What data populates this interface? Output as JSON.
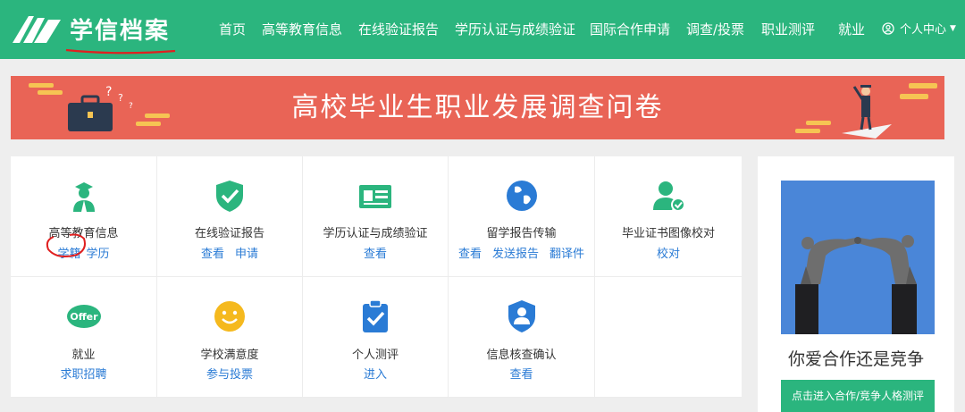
{
  "header": {
    "logo_text": "学信档案",
    "nav": [
      "首页",
      "高等教育信息",
      "在线验证报告",
      "学历认证与成绩验证",
      "国际合作申请",
      "调查/投票",
      "职业测评",
      "就业"
    ],
    "user_center": "个人中心",
    "brand_color": "#2bb57e"
  },
  "banner": {
    "title": "高校毕业生职业发展调查问卷",
    "color": "#e96456"
  },
  "services": [
    {
      "title": "高等教育信息",
      "links": [
        "学籍",
        "学历"
      ],
      "icon": "graduate-icon"
    },
    {
      "title": "在线验证报告",
      "links": [
        "查看",
        "申请"
      ],
      "icon": "shield-check-icon"
    },
    {
      "title": "学历认证与成绩验证",
      "links": [
        "查看"
      ],
      "icon": "id-card-icon"
    },
    {
      "title": "留学报告传输",
      "links": [
        "查看",
        "发送报告",
        "翻译件"
      ],
      "icon": "globe-icon"
    },
    {
      "title": "毕业证书图像校对",
      "links": [
        "校对"
      ],
      "icon": "user-check-icon"
    },
    {
      "title": "就业",
      "links": [
        "求职招聘"
      ],
      "icon": "offer-icon",
      "icon_text": "Offer"
    },
    {
      "title": "学校满意度",
      "links": [
        "参与投票"
      ],
      "icon": "smiley-icon"
    },
    {
      "title": "个人测评",
      "links": [
        "进入"
      ],
      "icon": "clipboard-check-icon"
    },
    {
      "title": "信息核查确认",
      "links": [
        "查看"
      ],
      "icon": "user-shield-icon"
    }
  ],
  "side": {
    "title": "你爱合作还是竞争",
    "button": "点击进入合作/竞争人格测评"
  }
}
